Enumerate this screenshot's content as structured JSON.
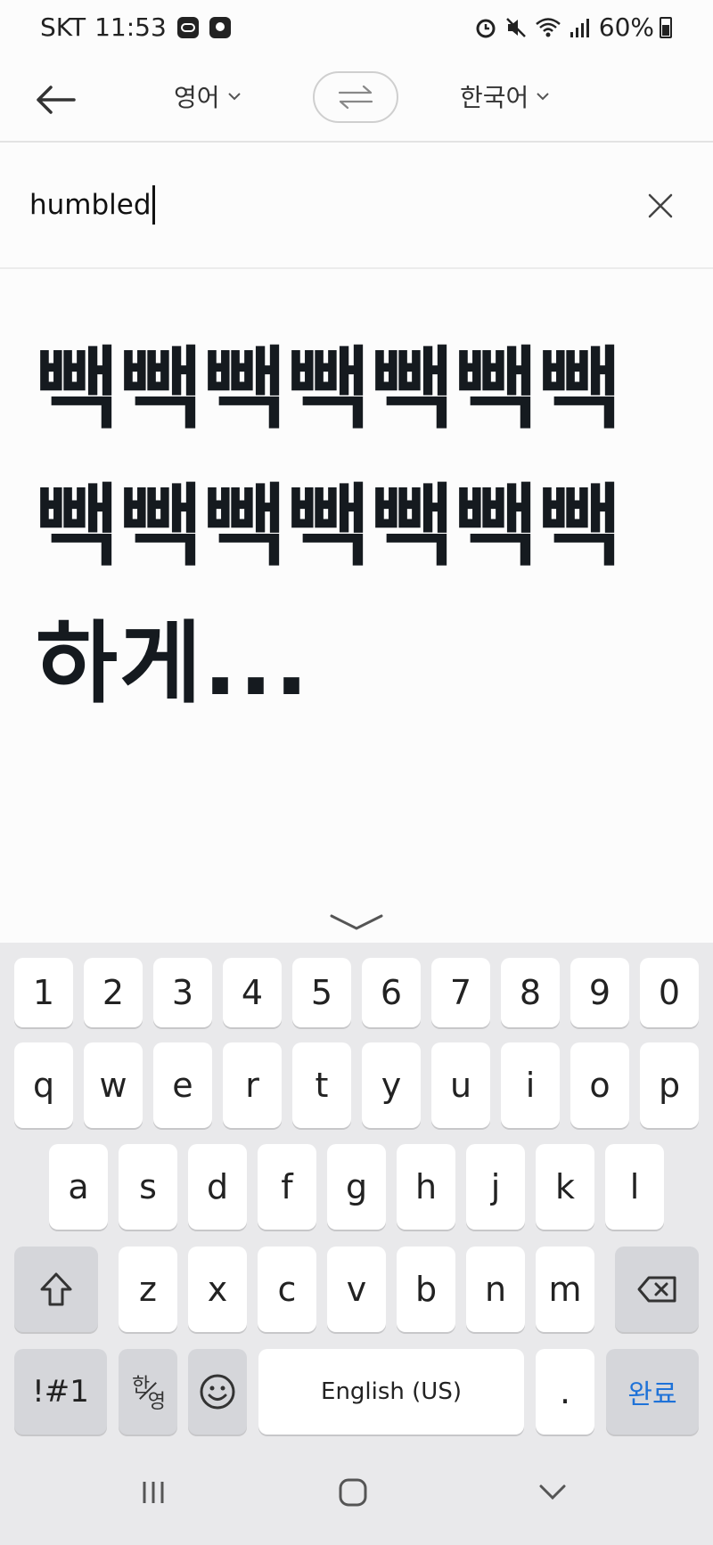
{
  "status_bar": {
    "carrier": "SKT",
    "time": "11:53",
    "battery": "60%"
  },
  "header": {
    "source_lang": "영어",
    "target_lang": "한국어"
  },
  "input": {
    "text": "humbled"
  },
  "result": {
    "text": "빽빽빽빽빽빽빽빽빽빽빽빽빽빽하게..."
  },
  "keyboard": {
    "row_numbers": [
      "1",
      "2",
      "3",
      "4",
      "5",
      "6",
      "7",
      "8",
      "9",
      "0"
    ],
    "row1": [
      "q",
      "w",
      "e",
      "r",
      "t",
      "y",
      "u",
      "i",
      "o",
      "p"
    ],
    "row2": [
      "a",
      "s",
      "d",
      "f",
      "g",
      "h",
      "j",
      "k",
      "l"
    ],
    "row3": [
      "z",
      "x",
      "c",
      "v",
      "b",
      "n",
      "m"
    ],
    "symbols_label": "!#1",
    "han_label": "한",
    "young_label": "영",
    "space_label": "English (US)",
    "period_label": ".",
    "done_label": "완료"
  },
  "colors": {
    "accent": "#1e72d8",
    "keyboard_bg": "#e9e9eb",
    "function_key": "#d5d6da"
  }
}
